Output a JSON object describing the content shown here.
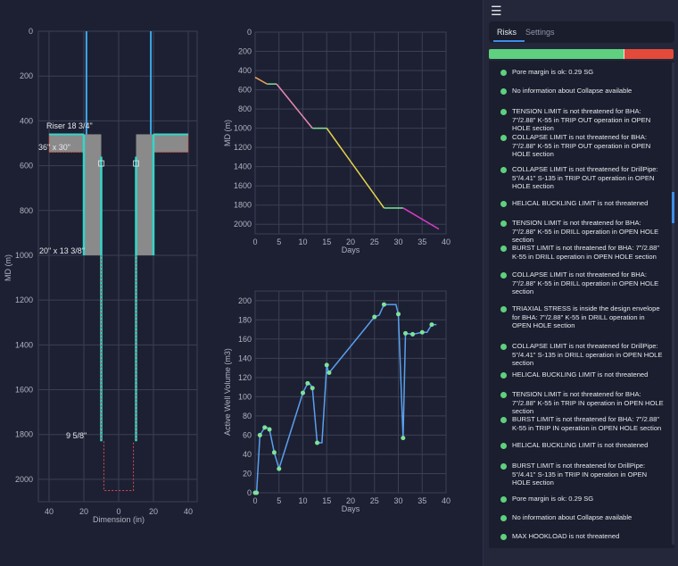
{
  "colors": {
    "grid": "#3a3f55",
    "axis": "#aeb3c2",
    "casing": "#32d7c8",
    "cement": "#8a8a8a",
    "line": "#5aa0f0",
    "dot": "#7ee29a",
    "ok": "#5ed07f",
    "bad": "#e34a3a",
    "accent": "#3d8de6"
  },
  "wellbore": {
    "xlabel": "Dimension (in)",
    "ylabel": "MD (m)",
    "x_ticks": [
      "40",
      "20",
      "0",
      "20",
      "40"
    ],
    "y_ticks": [
      "0",
      "200",
      "400",
      "600",
      "800",
      "1000",
      "1200",
      "1400",
      "1600",
      "1800",
      "2000"
    ],
    "labels": {
      "riser": "Riser 18 3/4\"",
      "conductor": "36\" x 30\"",
      "surface": "20\" x 13 3/8\"",
      "intermediate": "9 5/8\""
    }
  },
  "chart_data": [
    {
      "type": "line",
      "xlabel": "Days",
      "ylabel": "MD (m)",
      "xlim": [
        0,
        40
      ],
      "ylim": [
        2100,
        0
      ],
      "x_ticks": [
        0,
        5,
        10,
        15,
        20,
        25,
        30,
        35,
        40
      ],
      "y_ticks": [
        0,
        200,
        400,
        600,
        800,
        1000,
        1200,
        1400,
        1600,
        1800,
        2000
      ],
      "series": [
        {
          "color": "#f0a35a",
          "x": [
            0,
            2.5
          ],
          "y": [
            470,
            540
          ]
        },
        {
          "color": "#7ee29a",
          "x": [
            2.5,
            4.5
          ],
          "y": [
            540,
            540
          ]
        },
        {
          "color": "#e889b0",
          "x": [
            4.5,
            12
          ],
          "y": [
            540,
            1000
          ]
        },
        {
          "color": "#7ee29a",
          "x": [
            12,
            15
          ],
          "y": [
            1000,
            1000
          ]
        },
        {
          "color": "#e6d64a",
          "x": [
            15,
            27
          ],
          "y": [
            1000,
            1830
          ]
        },
        {
          "color": "#7ee29a",
          "x": [
            27,
            31
          ],
          "y": [
            1830,
            1830
          ]
        },
        {
          "color": "#d83bc8",
          "x": [
            31,
            38.5
          ],
          "y": [
            1830,
            2050
          ]
        }
      ]
    },
    {
      "type": "line",
      "xlabel": "Days",
      "ylabel": "Active Well Volume (m3)",
      "xlim": [
        0,
        40
      ],
      "ylim": [
        0,
        210
      ],
      "x_ticks": [
        0,
        5,
        10,
        15,
        20,
        25,
        30,
        35,
        40
      ],
      "y_ticks": [
        0,
        20,
        40,
        60,
        80,
        100,
        120,
        140,
        160,
        180,
        200
      ],
      "series": [
        {
          "name": "",
          "x": [
            0,
            0.3,
            1,
            2,
            2.5,
            3,
            4,
            5,
            10,
            11,
            11.5,
            12,
            13,
            14,
            15,
            15.3,
            15.5,
            25,
            26,
            27,
            29.5,
            30,
            31,
            31.5,
            33,
            35,
            36,
            37,
            38
          ],
          "y": [
            0,
            0,
            60,
            68,
            68,
            66,
            42,
            25,
            104,
            114,
            113,
            109,
            52,
            52,
            133,
            127,
            125,
            183,
            185,
            196,
            196,
            186,
            57,
            166,
            165,
            167,
            167,
            175,
            175
          ],
          "markers": [
            1,
            1,
            1,
            1,
            0,
            1,
            1,
            1,
            1,
            1,
            0,
            1,
            1,
            0,
            1,
            0,
            1,
            1,
            0,
            1,
            0,
            1,
            1,
            1,
            1,
            1,
            0,
            1,
            0
          ]
        }
      ]
    }
  ],
  "panel": {
    "tabs": [
      "Risks",
      "Settings"
    ],
    "risk_bar": {
      "ok_fraction": 0.73
    },
    "risks": [
      "Pore margin is ok: 0.29 SG",
      "No information about Collapse available",
      "TENSION LIMIT is not threatened for BHA: 7\"/2.88\" K-55 in TRIP OUT operation in OPEN HOLE section",
      "COLLAPSE LIMIT is not threatened for BHA: 7\"/2.88\" K-55 in TRIP OUT operation in OPEN HOLE section",
      "COLLAPSE LIMIT is not threatened for DrillPipe: 5\"/4.41\" S-135 in TRIP OUT operation in OPEN HOLE section",
      "HELICAL BUCKLING LIMIT is not threatened",
      "TENSION LIMIT is not threatened for BHA: 7\"/2.88\" K-55 in DRILL operation in OPEN HOLE section",
      "BURST LIMIT is not threatened for BHA: 7\"/2.88\" K-55 in DRILL operation in OPEN HOLE section",
      "COLLAPSE LIMIT is not threatened for BHA: 7\"/2.88\" K-55 in DRILL operation in OPEN HOLE section",
      "TRIAXIAL STRESS is inside the design envelope for BHA: 7\"/2.88\" K-55 in DRILL operation in OPEN HOLE section",
      "COLLAPSE LIMIT is not threatened for DrillPipe: 5\"/4.41\" S-135 in DRILL operation in OPEN HOLE section",
      "HELICAL BUCKLING LIMIT is not threatened",
      "TENSION LIMIT is not threatened for BHA: 7\"/2.88\" K-55 in TRIP IN operation in OPEN HOLE section",
      "BURST LIMIT is not threatened for BHA: 7\"/2.88\" K-55 in TRIP IN operation in OPEN HOLE section",
      "HELICAL BUCKLING LIMIT is not threatened",
      "BURST LIMIT is not threatened for DrillPipe: 5\"/4.41\" S-135 in TRIP IN operation in OPEN HOLE section",
      "Pore margin is ok: 0.29 SG",
      "No information about Collapse available",
      "MAX HOOKLOAD is not threatened"
    ]
  }
}
